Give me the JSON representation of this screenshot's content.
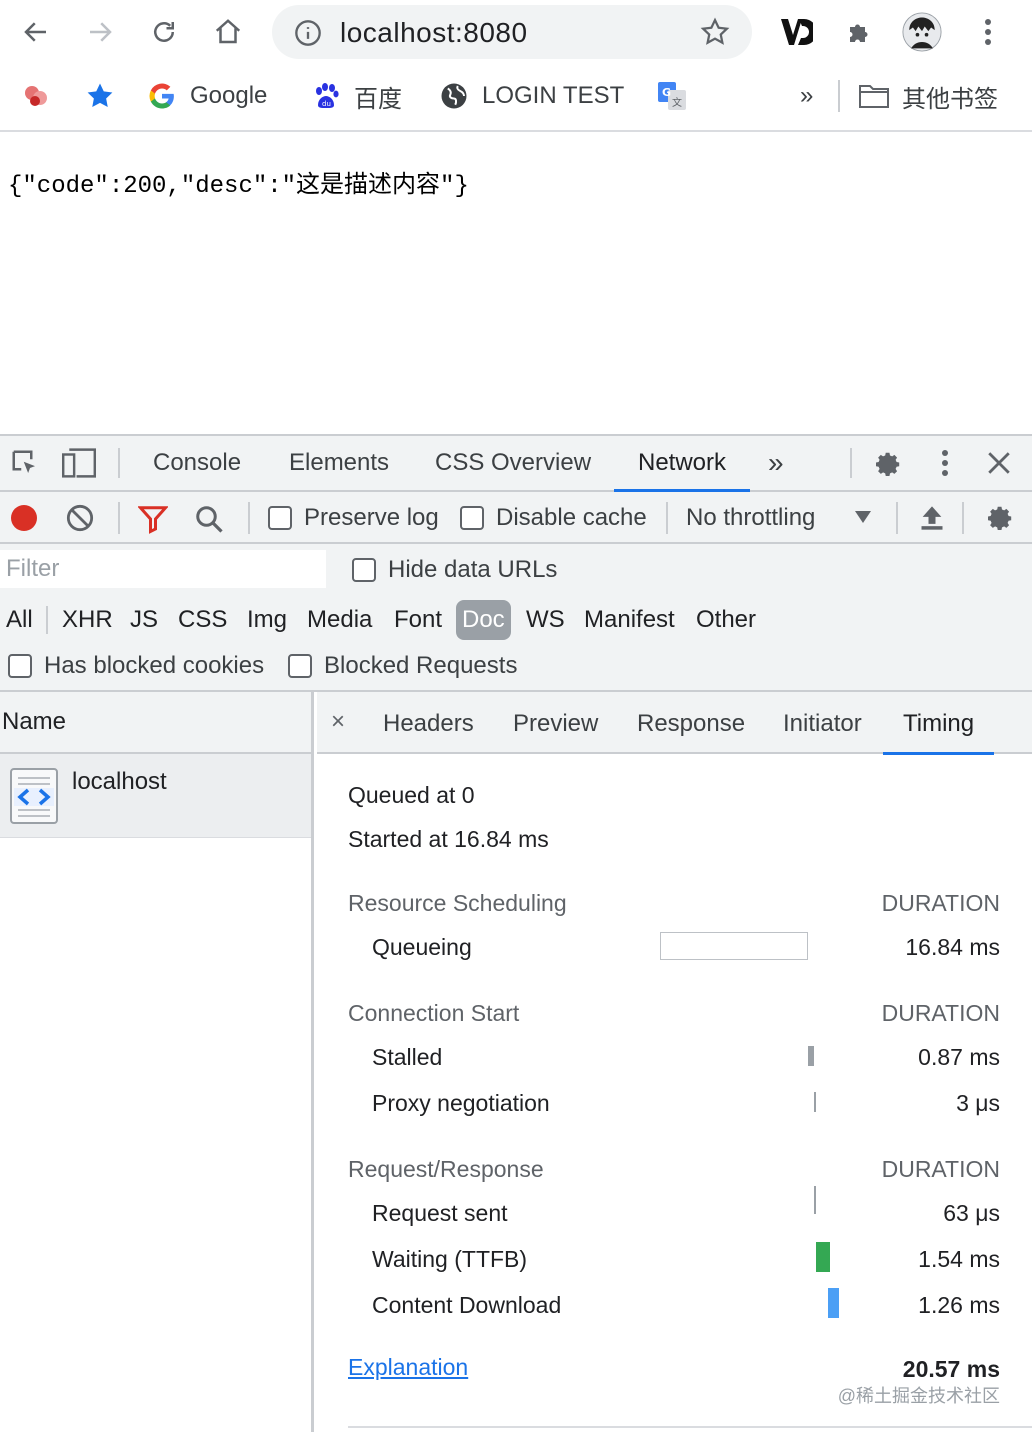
{
  "browser": {
    "url": "localhost:8080"
  },
  "bookmarks": {
    "items": [
      {
        "label": ""
      },
      {
        "label": ""
      },
      {
        "label": "Google"
      },
      {
        "label": "百度"
      },
      {
        "label": "LOGIN TEST"
      },
      {
        "label": ""
      }
    ],
    "overflow_label": "»",
    "folder_label": "其他书签"
  },
  "page": {
    "json_text": "{\"code\":200,\"desc\":\"这是描述内容\"}"
  },
  "devtools": {
    "tabs": [
      "Console",
      "Elements",
      "CSS Overview",
      "Network"
    ],
    "active_tab": "Network",
    "more_label": "»",
    "network_toolbar": {
      "preserve_log": "Preserve log",
      "disable_cache": "Disable cache",
      "throttling": "No throttling"
    },
    "filter": {
      "placeholder": "Filter",
      "hide_data_urls": "Hide data URLs",
      "types": [
        "All",
        "XHR",
        "JS",
        "CSS",
        "Img",
        "Media",
        "Font",
        "Doc",
        "WS",
        "Manifest",
        "Other"
      ],
      "active_type": "Doc",
      "has_blocked_cookies": "Has blocked cookies",
      "blocked_requests": "Blocked Requests"
    },
    "requests": {
      "column_name": "Name",
      "rows": [
        {
          "name": "localhost"
        }
      ]
    },
    "detail": {
      "close_label": "×",
      "tabs": [
        "Headers",
        "Preview",
        "Response",
        "Initiator",
        "Timing"
      ],
      "active_tab": "Timing",
      "timing": {
        "queued_at": "Queued at 0",
        "started_at": "Started at 16.84 ms",
        "sections": [
          {
            "title": "Resource Scheduling",
            "duration_label": "DURATION",
            "rows": [
              {
                "label": "Queueing",
                "value": "16.84 ms"
              }
            ]
          },
          {
            "title": "Connection Start",
            "duration_label": "DURATION",
            "rows": [
              {
                "label": "Stalled",
                "value": "0.87 ms"
              },
              {
                "label": "Proxy negotiation",
                "value": "3 μs"
              }
            ]
          },
          {
            "title": "Request/Response",
            "duration_label": "DURATION",
            "rows": [
              {
                "label": "Request sent",
                "value": "63 μs"
              },
              {
                "label": "Waiting (TTFB)",
                "value": "1.54 ms"
              },
              {
                "label": "Content Download",
                "value": "1.26 ms"
              }
            ]
          }
        ],
        "explanation": "Explanation",
        "total": "20.57 ms",
        "watermark": "@稀土掘金技术社区"
      }
    }
  },
  "colors": {
    "accent": "#1a73e8",
    "record": "#d93025",
    "ttfb_bar": "#34a853",
    "download_bar": "#4b9ff5"
  }
}
